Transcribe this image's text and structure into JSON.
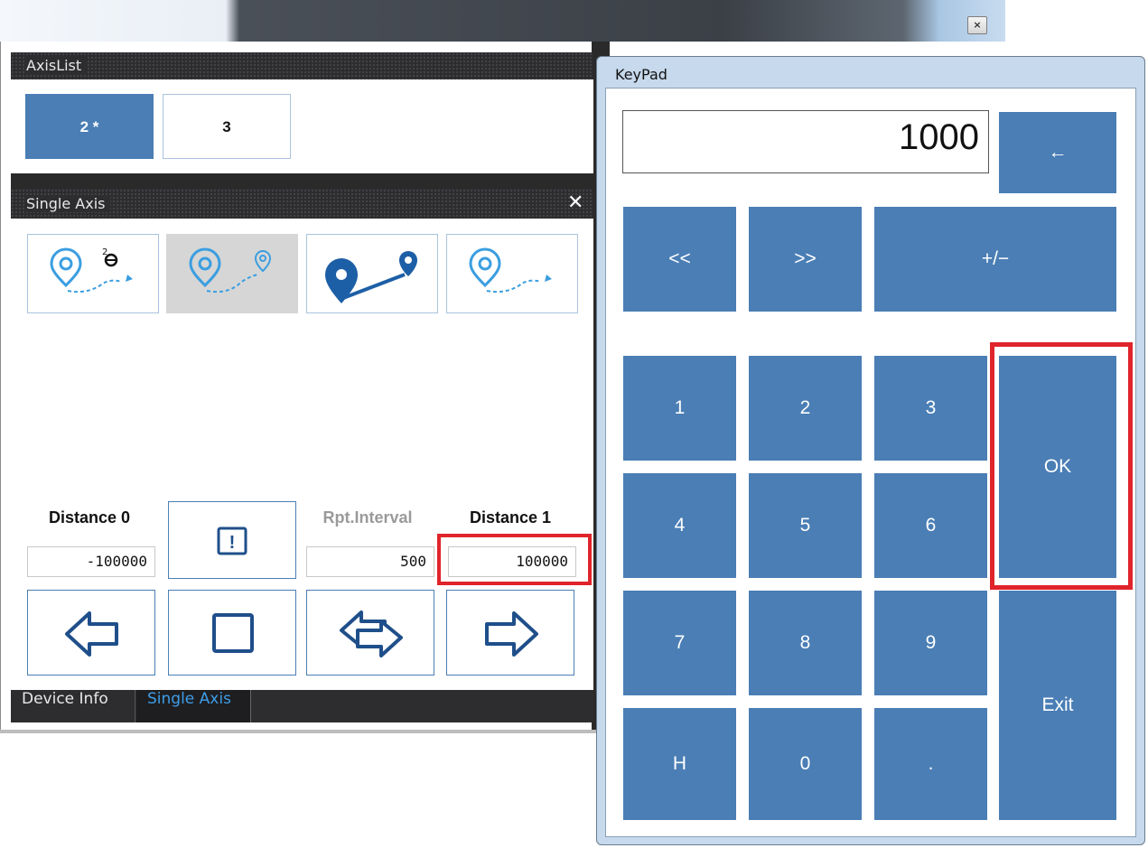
{
  "main_window": {
    "close_glyph": "×",
    "axis_list": {
      "title": "AxisList",
      "axes": [
        "2 *",
        "3"
      ]
    },
    "single_axis": {
      "title": "Single Axis",
      "close_glyph": "✕",
      "mode_icons": [
        "jog-mode-icon",
        "relative-move-icon",
        "absolute-move-icon",
        "continuous-move-icon"
      ],
      "distance0": {
        "label": "Distance 0",
        "value": "-100000"
      },
      "rpt_interval": {
        "label": "Rpt.Interval",
        "value": "500"
      },
      "distance1": {
        "label": "Distance 1",
        "value": "100000"
      },
      "alarm_icon_text": "!",
      "actions": [
        "move-left-arrow-icon",
        "stop-icon",
        "repeat-move-icon",
        "move-right-arrow-icon"
      ]
    },
    "tabs": [
      "Device Info",
      "Single Axis"
    ],
    "active_tab": "Single Axis"
  },
  "keypad": {
    "title": "KeyPad",
    "display_value": "1000",
    "backspace": "←",
    "row_nav": [
      "<<",
      ">>",
      "+/−"
    ],
    "digits": [
      "1",
      "2",
      "3",
      "4",
      "5",
      "6",
      "7",
      "8",
      "9",
      "H",
      "0",
      "."
    ],
    "ok": "OK",
    "exit": "Exit"
  },
  "highlight_color": "#e0242b",
  "accent_color": "#4a7eb5"
}
